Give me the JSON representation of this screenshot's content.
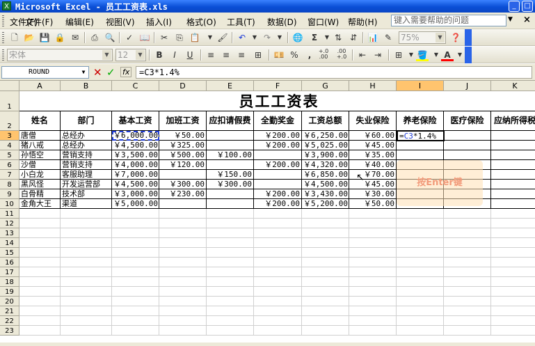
{
  "window": {
    "title": "Microsoft Excel - 员工工资表.xls",
    "buttons": [
      "_",
      "□"
    ]
  },
  "menu": {
    "items": [
      "文件(F)",
      "编辑(E)",
      "视图(V)",
      "插入(I)",
      "格式(O)",
      "工具(T)",
      "数据(D)",
      "窗口(W)",
      "帮助(H)"
    ],
    "help_placeholder": "键入需要帮助的问题",
    "close": "×"
  },
  "toolbar": {
    "zoom": "75%",
    "font_name": "宋体",
    "font_size": "12",
    "bold": "B",
    "italic": "I",
    "underline": "U",
    "percent": "%",
    "comma": ",",
    "increase_decimal": "+.0\n.00",
    "decrease_decimal": ".00\n+.0",
    "font_color_letter": "A",
    "sigma": "Σ"
  },
  "formula_bar": {
    "name_box": "ROUND",
    "fx": "fx",
    "formula": "=C3*1.4%"
  },
  "sheet": {
    "columns": [
      "A",
      "B",
      "C",
      "D",
      "E",
      "F",
      "G",
      "H",
      "I",
      "J",
      "K"
    ],
    "selected_column": "I",
    "selected_row": "3",
    "title": "员工工资表",
    "headers": [
      "姓名",
      "部门",
      "基本工资",
      "加班工资",
      "应扣请假费",
      "全勤奖金",
      "工资总额",
      "失业保险",
      "养老保险",
      "医疗保险",
      "应纳所得税"
    ],
    "rows": [
      [
        "唐僧",
        "总经办",
        "￥6,000.00",
        "￥50.00",
        "",
        "￥200.00",
        "￥6,250.00",
        "￥60.00",
        "=C3*1.4%",
        "",
        ""
      ],
      [
        "猪八戒",
        "总经办",
        "￥4,500.00",
        "￥325.00",
        "",
        "￥200.00",
        "￥5,025.00",
        "￥45.00",
        "",
        "",
        ""
      ],
      [
        "孙悟空",
        "营销支持",
        "￥3,500.00",
        "￥500.00",
        "￥100.00",
        "",
        "￥3,900.00",
        "￥35.00",
        "",
        "",
        ""
      ],
      [
        "沙僧",
        "营销支持",
        "￥4,000.00",
        "￥120.00",
        "",
        "￥200.00",
        "￥4,320.00",
        "￥40.00",
        "",
        "",
        ""
      ],
      [
        "小白龙",
        "客服助理",
        "￥7,000.00",
        "",
        "￥150.00",
        "",
        "￥6,850.00",
        "￥70.00",
        "",
        "",
        ""
      ],
      [
        "黑风怪",
        "开发运营部",
        "￥4,500.00",
        "￥300.00",
        "￥300.00",
        "",
        "￥4,500.00",
        "￥45.00",
        "",
        "",
        ""
      ],
      [
        "白骨精",
        "技术部",
        "￥3,000.00",
        "￥230.00",
        "",
        "￥200.00",
        "￥3,430.00",
        "￥30.00",
        "",
        "",
        ""
      ],
      [
        "金角大王",
        "渠道",
        "￥5,000.00",
        "",
        "",
        "￥200.00",
        "￥5,200.00",
        "￥50.00",
        "",
        "",
        ""
      ]
    ],
    "row_numbers": [
      "1",
      "2",
      "3",
      "4",
      "5",
      "6",
      "7",
      "8",
      "9",
      "10",
      "11",
      "12",
      "13",
      "14",
      "15",
      "16",
      "17",
      "18",
      "19",
      "20",
      "21",
      "22",
      "23"
    ]
  },
  "active_cell": {
    "ref_text": "C3",
    "rest_text": "*1.4%",
    "prefix": "="
  },
  "tip": "按Enter键",
  "colors": {
    "title_bar": "#0a4fd6",
    "chrome": "#ece9d8",
    "selection_header": "#ffc46e",
    "ref_blue": "#1f3dd8"
  }
}
